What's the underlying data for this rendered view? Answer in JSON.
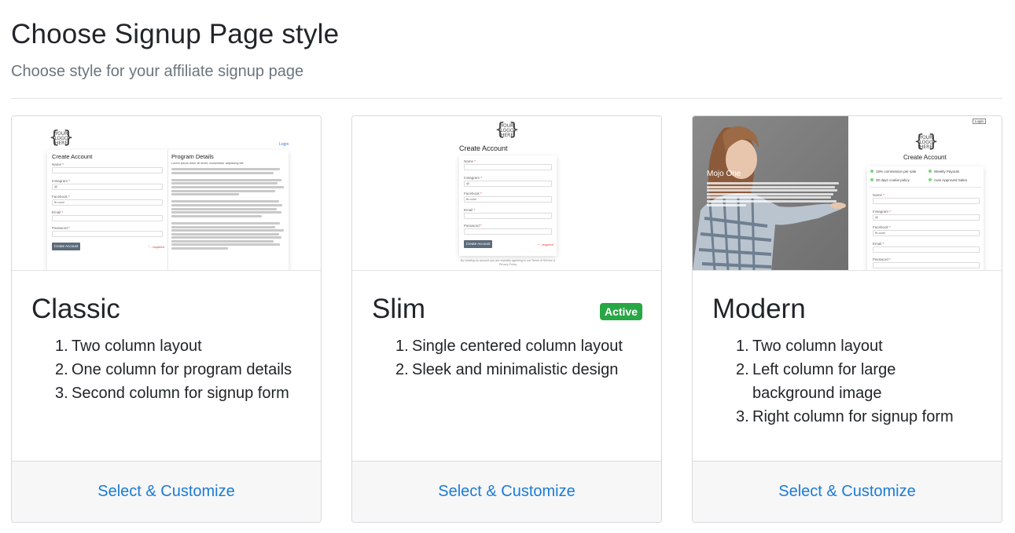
{
  "header": {
    "title": "Choose Signup Page style",
    "subtitle": "Choose style for your affiliate signup page"
  },
  "colors": {
    "accent_link": "#1a7bd8",
    "active_badge": "#28a745",
    "footer_bg": "#f7f7f7"
  },
  "cards": [
    {
      "title": "Classic",
      "badge": "",
      "features": [
        {
          "num": "1.",
          "text": "Two column layout"
        },
        {
          "num": "2.",
          "text": "One column for program details"
        },
        {
          "num": "3.",
          "text": "Second column for signup form"
        }
      ],
      "select_label": "Select & Customize",
      "preview": {
        "logo": [
          "YOUR",
          "LOGO",
          "HERE"
        ],
        "login": "Login",
        "form_title": "Create Account",
        "details_title": "Program Details",
        "fields": [
          "Name",
          "Instagram",
          "Facebook",
          "Email",
          "Password"
        ],
        "instagram_prefix": "@",
        "facebook_prefix": "fb.com/",
        "button": "Create Account",
        "required": "* - required",
        "details_intro": "Lorem ipsum dolor sit amet, consectetur adipiscing elit."
      }
    },
    {
      "title": "Slim",
      "badge": "Active",
      "features": [
        {
          "num": "1.",
          "text": "Single centered column layout"
        },
        {
          "num": "2.",
          "text": "Sleek and minimalistic design"
        }
      ],
      "select_label": "Select & Customize",
      "preview": {
        "logo": [
          "YOUR",
          "LOGO",
          "HERE"
        ],
        "form_title": "Create Account",
        "fields": [
          "Name",
          "Instagram",
          "Facebook",
          "Email",
          "Password"
        ],
        "instagram_prefix": "@",
        "facebook_prefix": "fb.com/",
        "button": "Create Account",
        "required": "* - required",
        "terms": "By creating an account you are explicitly agreeing to our Terms of Service & Privacy Policy"
      }
    },
    {
      "title": "Modern",
      "badge": "",
      "features": [
        {
          "num": "1.",
          "text": "Two column layout"
        },
        {
          "num": "2.",
          "text": "Left column for large background image"
        },
        {
          "num": "3.",
          "text": "Right column for signup form"
        }
      ],
      "select_label": "Select & Customize",
      "preview": {
        "logo": [
          "YOUR",
          "LOGO",
          "HERE"
        ],
        "login": "Login",
        "brand": "Mojo One",
        "form_title": "Create Account",
        "perks": [
          "15% commission per sale",
          "Weekly Payouts",
          "30 days cookie policy",
          "Auto Approved Sales"
        ],
        "fields": [
          "Name",
          "Instagram",
          "Facebook",
          "Email",
          "Password"
        ],
        "instagram_prefix": "@",
        "facebook_prefix": "fb.com/"
      }
    }
  ]
}
